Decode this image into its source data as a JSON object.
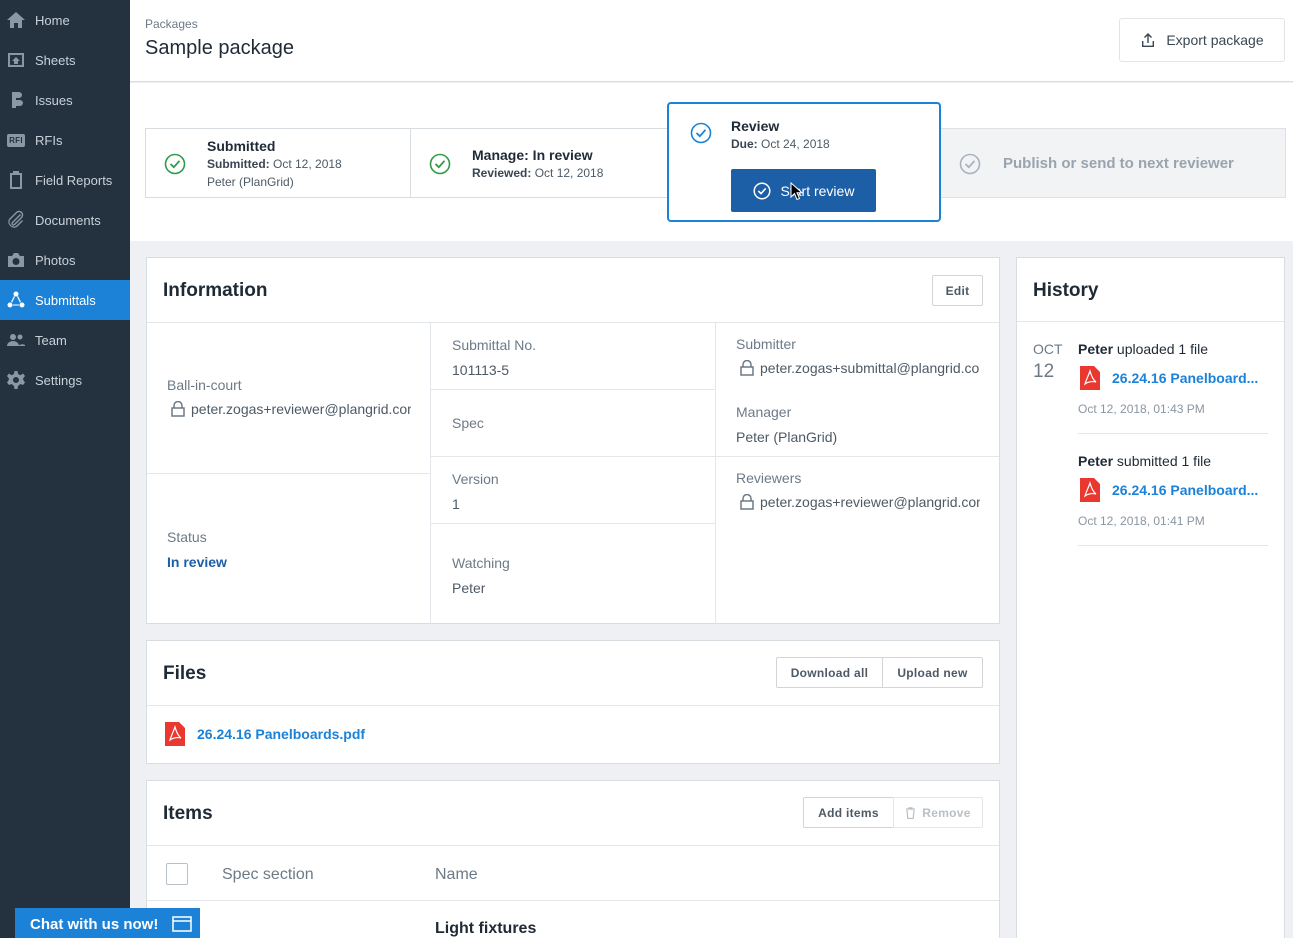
{
  "sidebar": {
    "items": [
      {
        "label": "Home",
        "icon": "home-icon"
      },
      {
        "label": "Sheets",
        "icon": "sheets-icon"
      },
      {
        "label": "Issues",
        "icon": "issues-icon"
      },
      {
        "label": "RFIs",
        "icon": "rfi-icon",
        "badge": "RFI"
      },
      {
        "label": "Field Reports",
        "icon": "clipboard-icon"
      },
      {
        "label": "Documents",
        "icon": "paperclip-icon"
      },
      {
        "label": "Photos",
        "icon": "camera-icon"
      },
      {
        "label": "Submittals",
        "icon": "submittals-icon",
        "active": true
      },
      {
        "label": "Team",
        "icon": "team-icon"
      },
      {
        "label": "Settings",
        "icon": "gear-icon"
      }
    ]
  },
  "header": {
    "breadcrumb": "Packages",
    "title": "Sample package",
    "export_label": "Export package"
  },
  "stepper": {
    "submitted": {
      "title": "Submitted",
      "line1_key": "Submitted:",
      "line1_val": " Oct 12, 2018",
      "line2": "Peter (PlanGrid)"
    },
    "manage": {
      "title": "Manage: In review",
      "line1_key": "Reviewed:",
      "line1_val": " Oct 12, 2018"
    },
    "review": {
      "title": "Review",
      "line1_key": "Due:",
      "line1_val": " Oct 24, 2018",
      "button": "Start review"
    },
    "publish": {
      "title": "Publish or send to next reviewer"
    }
  },
  "information": {
    "title": "Information",
    "edit_label": "Edit",
    "ball_in_court_label": "Ball-in-court",
    "ball_in_court_value": "peter.zogas+reviewer@plangrid.com",
    "status_label": "Status",
    "status_value": "In review",
    "submittal_no_label": "Submittal No.",
    "submittal_no_value": "101113-5",
    "spec_label": "Spec",
    "version_label": "Version",
    "version_value": "1",
    "watching_label": "Watching",
    "watching_value": "Peter",
    "submitter_label": "Submitter",
    "submitter_value": "peter.zogas+submittal@plangrid.com",
    "manager_label": "Manager",
    "manager_value": "Peter (PlanGrid)",
    "reviewers_label": "Reviewers",
    "reviewers_value": "peter.zogas+reviewer@plangrid.com"
  },
  "files": {
    "title": "Files",
    "download_all": "Download all",
    "upload_new": "Upload new",
    "items": [
      "26.24.16 Panelboards.pdf"
    ]
  },
  "items": {
    "title": "Items",
    "add_items": "Add items",
    "remove": "Remove",
    "col_spec": "Spec section",
    "col_name": "Name",
    "rows": [
      {
        "name": "Light fixtures"
      }
    ]
  },
  "history": {
    "title": "History",
    "month": "OCT",
    "day": "12",
    "entries": [
      {
        "user": "Peter",
        "action": " uploaded 1 file",
        "file": "26.24.16 Panelboard...",
        "time": "Oct 12, 2018, 01:43 PM"
      },
      {
        "user": "Peter",
        "action": " submitted 1 file",
        "file": "26.24.16 Panelboard...",
        "time": "Oct 12, 2018, 01:41 PM"
      }
    ]
  },
  "chat": {
    "label": "Chat with us now!"
  },
  "colors": {
    "accent": "#1b82d8",
    "sidebar": "#24323f",
    "primary_button": "#1d5fa6",
    "success": "#2e9b47",
    "pdf": "#e8382f"
  }
}
